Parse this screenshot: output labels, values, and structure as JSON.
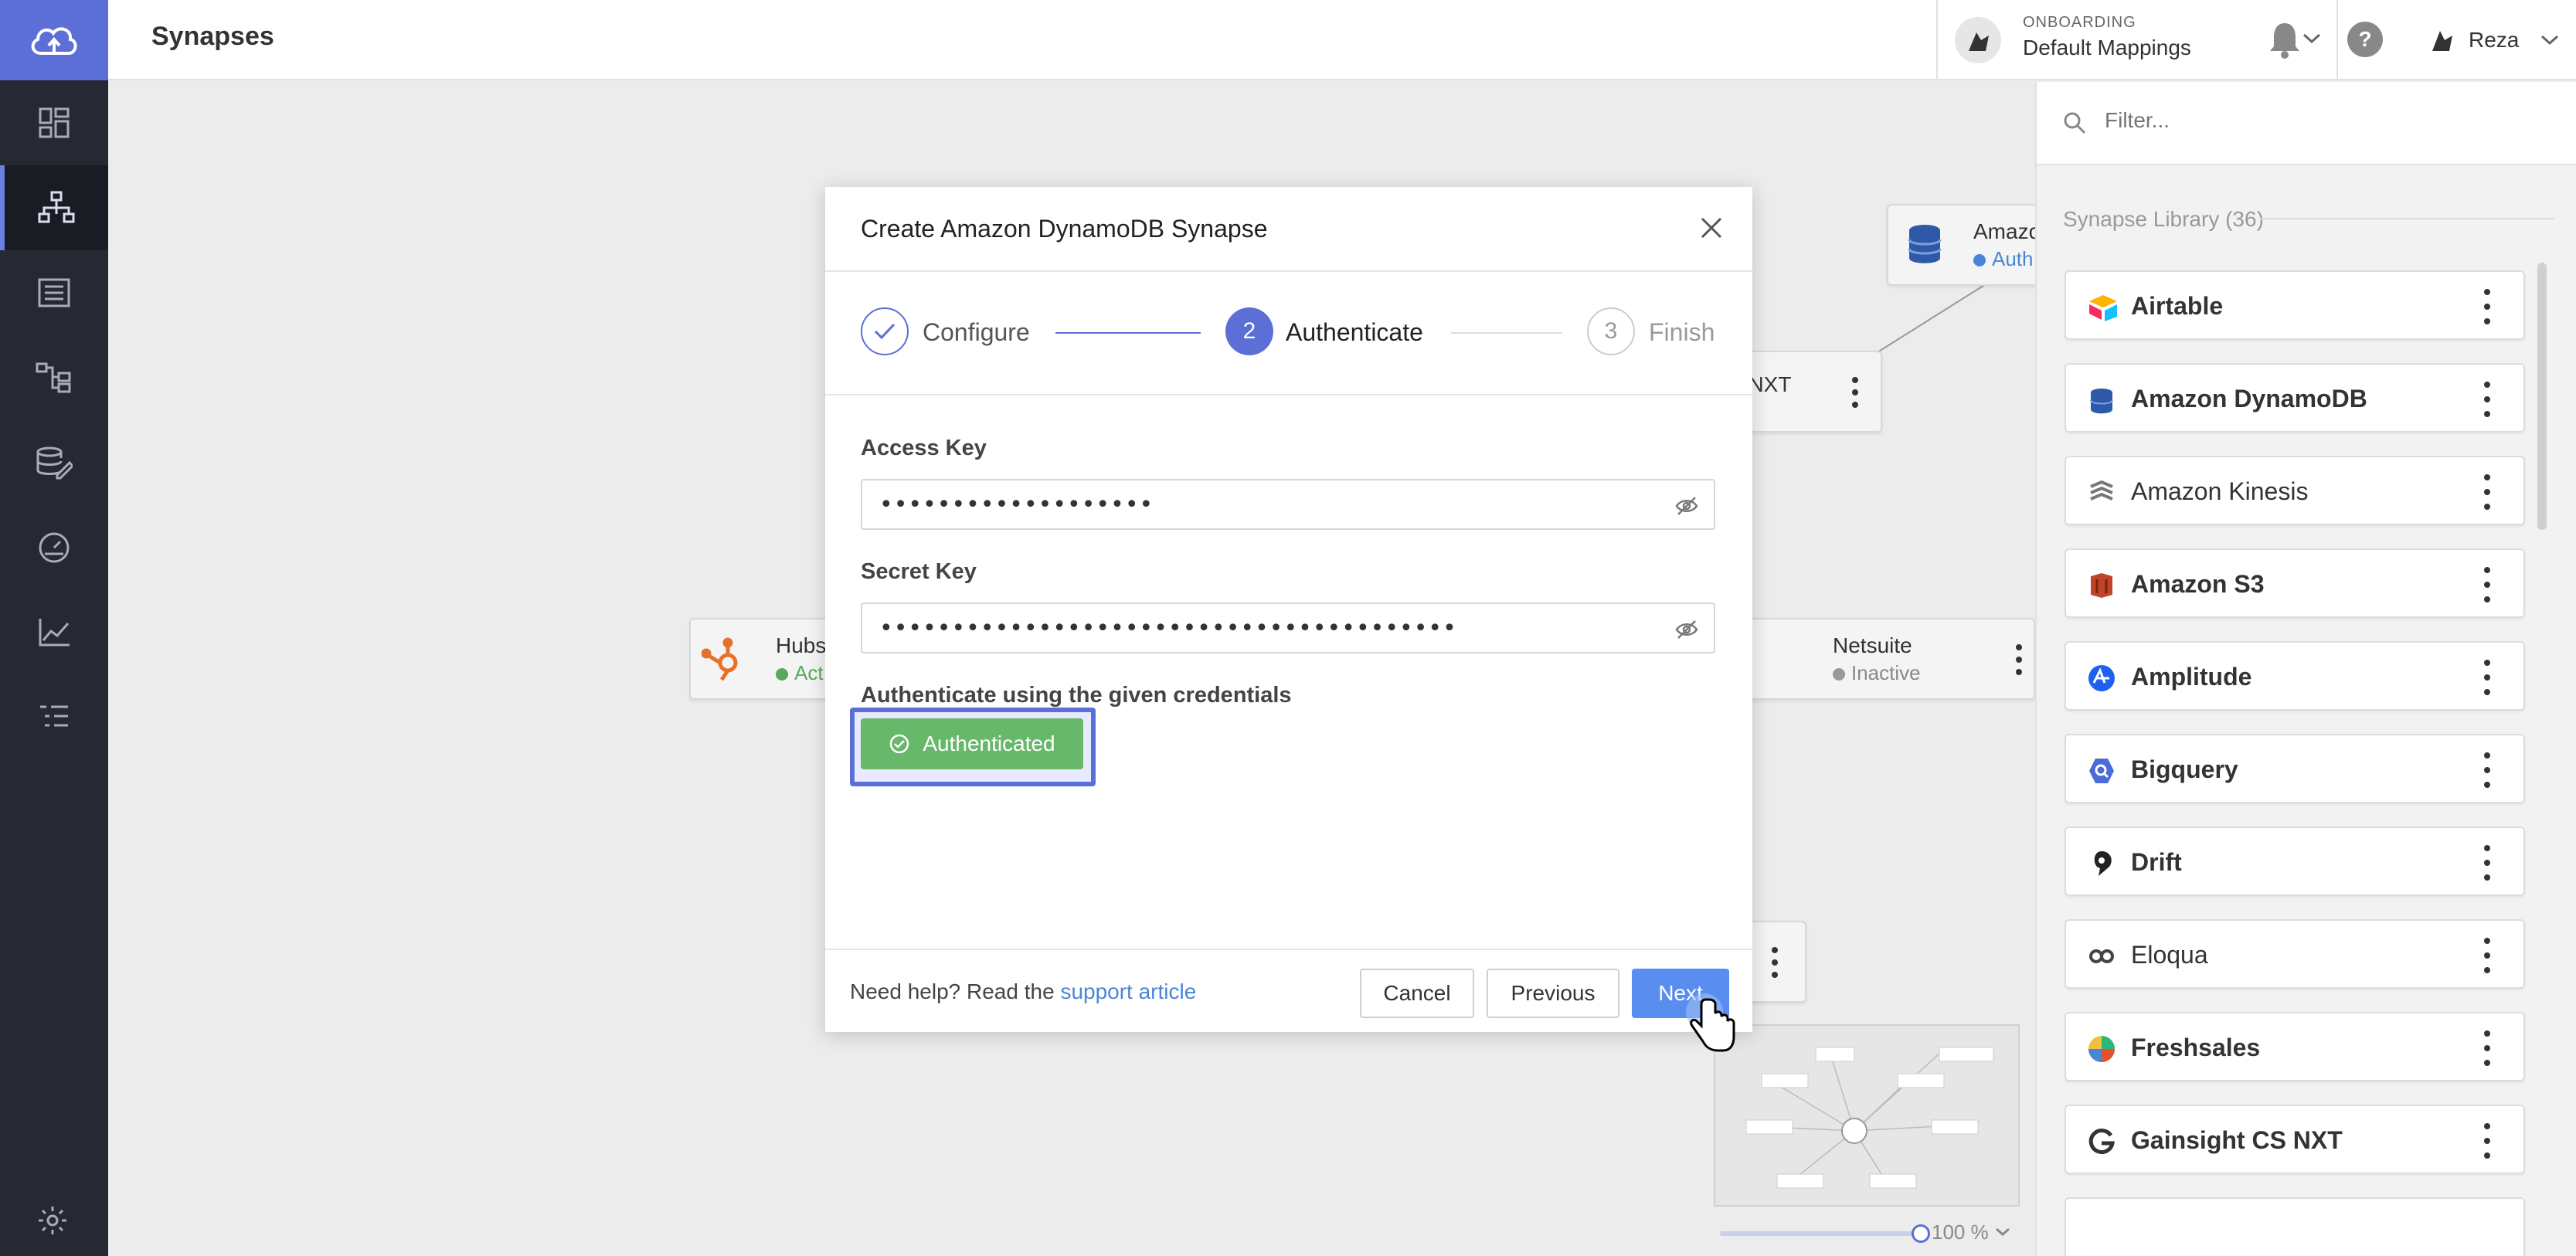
{
  "app": {
    "title": "Synapses"
  },
  "header": {
    "onboarding_label": "ONBOARDING",
    "onboarding_value": "Default Mappings",
    "user_name": "Reza"
  },
  "canvas": {
    "nodes": [
      {
        "name": "Amazo",
        "status": "Auth"
      },
      {
        "name": "S NXT"
      },
      {
        "name": "Hubs",
        "status": "Act"
      },
      {
        "name": "Netsuite",
        "status": "Inactive"
      }
    ],
    "zoom": "100 %"
  },
  "library": {
    "filter_placeholder": "Filter...",
    "title": "Synapse Library (36)",
    "items": [
      {
        "label": "Airtable",
        "icon": "airtable-icon"
      },
      {
        "label": "Amazon DynamoDB",
        "icon": "dynamodb-icon"
      },
      {
        "label": "Amazon Kinesis",
        "icon": "kinesis-icon"
      },
      {
        "label": "Amazon S3",
        "icon": "s3-icon"
      },
      {
        "label": "Amplitude",
        "icon": "amplitude-icon"
      },
      {
        "label": "Bigquery",
        "icon": "bigquery-icon"
      },
      {
        "label": "Drift",
        "icon": "drift-icon"
      },
      {
        "label": "Eloqua",
        "icon": "eloqua-icon"
      },
      {
        "label": "Freshsales",
        "icon": "freshsales-icon"
      },
      {
        "label": "Gainsight CS NXT",
        "icon": "gainsight-icon"
      }
    ]
  },
  "modal": {
    "title": "Create Amazon DynamoDB Synapse",
    "steps": [
      {
        "number": "",
        "label": "Configure",
        "state": "done"
      },
      {
        "number": "2",
        "label": "Authenticate",
        "state": "active"
      },
      {
        "number": "3",
        "label": "Finish",
        "state": "pending"
      }
    ],
    "access_key_label": "Access Key",
    "access_key_value": "•••••••••••••••••••",
    "secret_key_label": "Secret Key",
    "secret_key_value": "••••••••••••••••••••••••••••••••••••••••",
    "auth_label": "Authenticate using the given credentials",
    "auth_button": "Authenticated",
    "help_text": "Need help? Read the",
    "help_link": "support article",
    "cancel": "Cancel",
    "previous": "Previous",
    "next": "Next"
  },
  "colors": {
    "nav_bg": "#262833",
    "accent": "#5b6fd6",
    "success": "#67b86a",
    "primary_button": "#5a8df0"
  }
}
